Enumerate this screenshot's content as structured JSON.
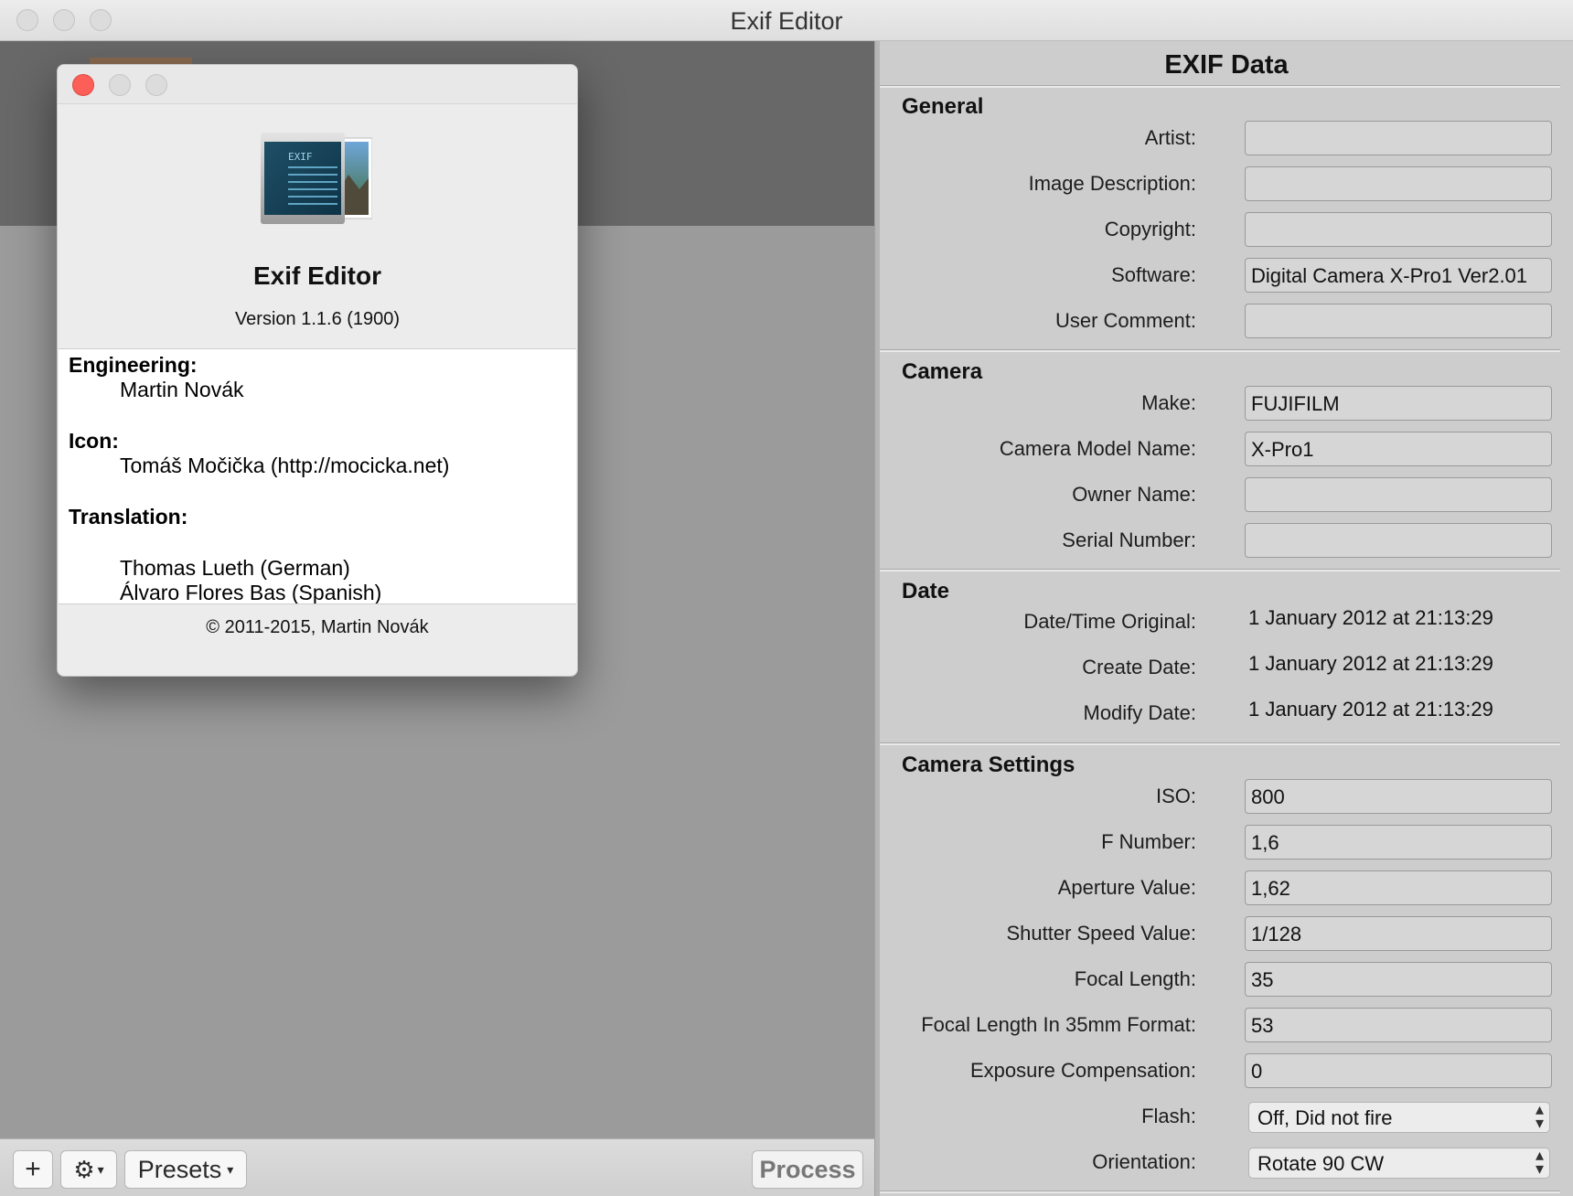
{
  "window": {
    "title": "Exif Editor"
  },
  "bottom_bar": {
    "add_label": "+",
    "gear_label": "⚙",
    "presets_label": "Presets",
    "process_label": "Process"
  },
  "exif": {
    "title": "EXIF Data",
    "general": {
      "heading": "General",
      "fields": [
        {
          "label": "Artist:",
          "value": ""
        },
        {
          "label": "Image Description:",
          "value": ""
        },
        {
          "label": "Copyright:",
          "value": ""
        },
        {
          "label": "Software:",
          "value": "Digital Camera X-Pro1 Ver2.01"
        },
        {
          "label": "User Comment:",
          "value": ""
        }
      ]
    },
    "camera": {
      "heading": "Camera",
      "fields": [
        {
          "label": "Make:",
          "value": "FUJIFILM"
        },
        {
          "label": "Camera Model Name:",
          "value": "X-Pro1"
        },
        {
          "label": "Owner Name:",
          "value": ""
        },
        {
          "label": "Serial Number:",
          "value": ""
        }
      ]
    },
    "date": {
      "heading": "Date",
      "fields": [
        {
          "label": "Date/Time Original:",
          "value": "1 January 2012 at 21:13:29"
        },
        {
          "label": "Create Date:",
          "value": "1 January 2012 at 21:13:29"
        },
        {
          "label": "Modify Date:",
          "value": "1 January 2012 at 21:13:29"
        }
      ]
    },
    "camera_settings": {
      "heading": "Camera Settings",
      "fields": [
        {
          "label": "ISO:",
          "value": "800"
        },
        {
          "label": "F Number:",
          "value": "1,6"
        },
        {
          "label": "Aperture Value:",
          "value": "1,62"
        },
        {
          "label": "Shutter Speed Value:",
          "value": "1/128"
        },
        {
          "label": "Focal Length:",
          "value": "35"
        },
        {
          "label": "Focal Length In 35mm Format:",
          "value": "53"
        },
        {
          "label": "Exposure Compensation:",
          "value": "0"
        }
      ],
      "flash": {
        "label": "Flash:",
        "value": "Off, Did not fire"
      },
      "orientation": {
        "label": "Orientation:",
        "value": "Rotate 90 CW"
      }
    }
  },
  "about": {
    "app_name": "Exif Editor",
    "version": "Version 1.1.6 (1900)",
    "icon_text": "EXIF",
    "credits": {
      "engineering_heading": "Engineering:",
      "engineering_name": "Martin Novák",
      "icon_heading": "Icon:",
      "icon_name": "Tomáš Močička (http://mocicka.net)",
      "translation_heading": "Translation:",
      "translators": [
        "Thomas Lueth (German)",
        "Álvaro Flores Bas (Spanish)"
      ]
    },
    "copyright": "© 2011-2015, Martin Novák"
  },
  "colors": {
    "close_red": "#fc5f57",
    "inactive_traffic": "#dcdcdc",
    "pane_grey": "#9b9b9b",
    "strip_dark": "#686868"
  }
}
